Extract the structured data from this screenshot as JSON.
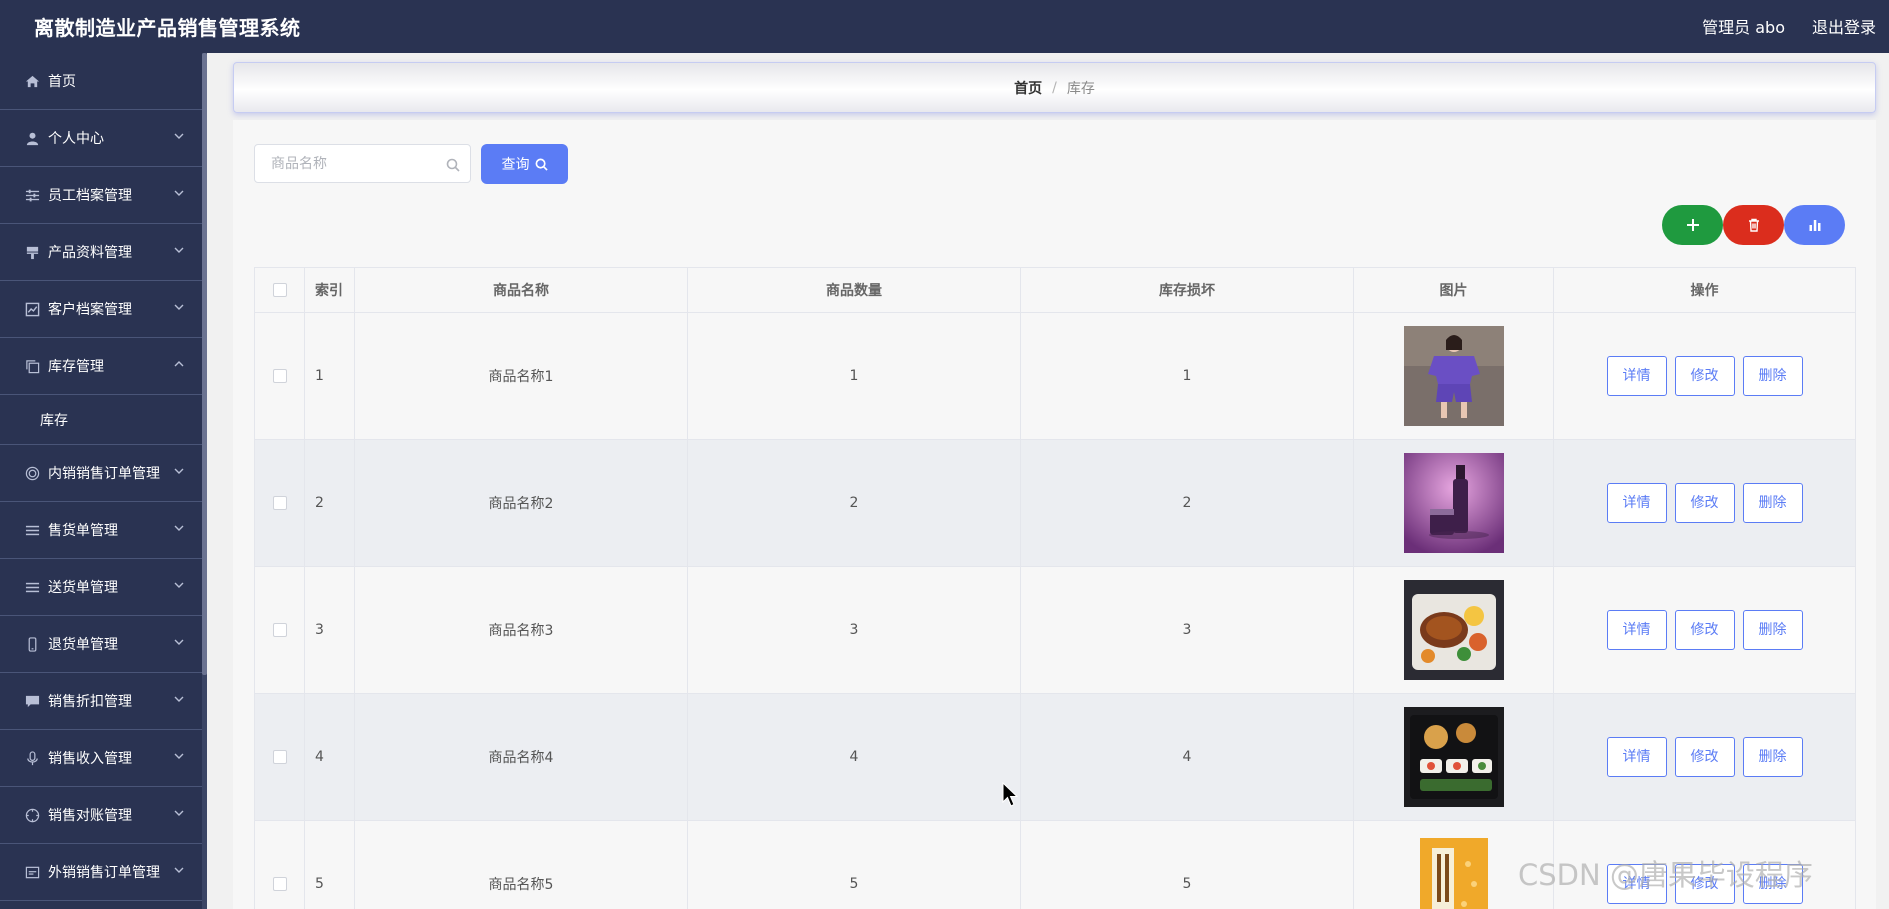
{
  "header": {
    "title": "离散制造业产品销售管理系统",
    "user": "管理员 abo",
    "logout": "退出登录"
  },
  "sidebar": {
    "items": [
      {
        "label": "首页",
        "icon": "home-icon",
        "has_children": false
      },
      {
        "label": "个人中心",
        "icon": "user-icon",
        "has_children": true
      },
      {
        "label": "员工档案管理",
        "icon": "sliders-icon",
        "has_children": true
      },
      {
        "label": "产品资料管理",
        "icon": "brush-icon",
        "has_children": true
      },
      {
        "label": "客户档案管理",
        "icon": "chart-line-icon",
        "has_children": true
      },
      {
        "label": "库存管理",
        "icon": "copy-icon",
        "has_children": true,
        "expanded": true,
        "children": [
          "库存"
        ]
      },
      {
        "label": "内销销售订单管理",
        "icon": "circle-icon",
        "has_children": true
      },
      {
        "label": "售货单管理",
        "icon": "list-icon",
        "has_children": true
      },
      {
        "label": "送货单管理",
        "icon": "list-icon",
        "has_children": true
      },
      {
        "label": "退货单管理",
        "icon": "phone-icon",
        "has_children": true
      },
      {
        "label": "销售折扣管理",
        "icon": "chat-icon",
        "has_children": true
      },
      {
        "label": "销售收入管理",
        "icon": "mic-icon",
        "has_children": true
      },
      {
        "label": "销售对账管理",
        "icon": "compass-icon",
        "has_children": true
      },
      {
        "label": "外销销售订单管理",
        "icon": "message-icon",
        "has_children": true
      }
    ]
  },
  "breadcrumb": {
    "home": "首页",
    "separator": "/",
    "current": "库存"
  },
  "search": {
    "placeholder": "商品名称",
    "value": "",
    "button": "查询"
  },
  "actions": {
    "add_icon": "plus-icon",
    "delete_icon": "trash-icon",
    "stats_icon": "bar-chart-icon"
  },
  "table": {
    "columns": [
      "索引",
      "商品名称",
      "商品数量",
      "库存损坏",
      "图片",
      "操作"
    ],
    "rows": [
      {
        "index": "1",
        "name": "商品名称1",
        "quantity": "1",
        "damaged": "1",
        "image": "purple-outfit"
      },
      {
        "index": "2",
        "name": "商品名称2",
        "quantity": "2",
        "damaged": "2",
        "image": "purple-cosmetics"
      },
      {
        "index": "3",
        "name": "商品名称3",
        "quantity": "3",
        "damaged": "3",
        "image": "bento-meal"
      },
      {
        "index": "4",
        "name": "商品名称4",
        "quantity": "4",
        "damaged": "4",
        "image": "sushi-box"
      },
      {
        "index": "5",
        "name": "商品名称5",
        "quantity": "5",
        "damaged": "5",
        "image": "yellow-book"
      }
    ],
    "row_actions": {
      "detail": "详情",
      "edit": "修改",
      "delete": "删除"
    }
  },
  "watermark": "CSDN @唐果毕设程序",
  "colors": {
    "header_bg": "#2a3352",
    "primary": "#5b7cf5",
    "add": "#1f9a3f",
    "danger": "#db2d1d"
  }
}
